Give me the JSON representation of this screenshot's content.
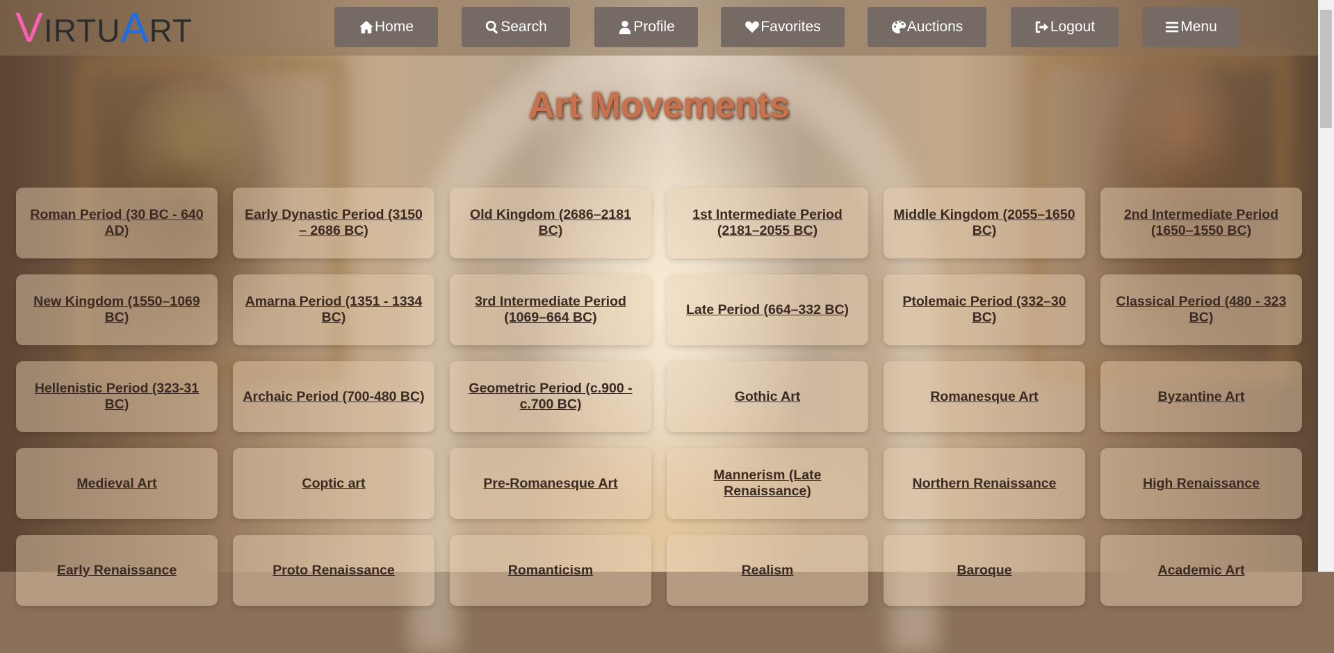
{
  "brand": {
    "v": "V",
    "irtu": "IRTU",
    "a": "A",
    "rt": "RT"
  },
  "nav": [
    {
      "label": "Home",
      "icon": "home-icon"
    },
    {
      "label": "Search",
      "icon": "search-icon"
    },
    {
      "label": "Profile",
      "icon": "user-icon"
    },
    {
      "label": "Favorites",
      "icon": "heart-icon"
    },
    {
      "label": "Auctions",
      "icon": "palette-icon"
    },
    {
      "label": "Logout",
      "icon": "sign-out-icon"
    },
    {
      "label": "Menu",
      "icon": "bars-icon"
    }
  ],
  "page_title": "Art Movements",
  "movements": [
    "Roman Period (30 BC - 640 AD)",
    "Early Dynastic Period (3150 – 2686 BC)",
    "Old Kingdom (2686–2181 BC)",
    "1st Intermediate Period (2181–2055 BC)",
    "Middle Kingdom (2055–1650 BC)",
    "2nd Intermediate Period (1650–1550 BC)",
    "New Kingdom (1550–1069 BC)",
    "Amarna Period (1351 - 1334 BC)",
    "3rd Intermediate Period (1069–664 BC)",
    "Late Period (664–332 BC)",
    "Ptolemaic Period (332–30 BC)",
    "Classical Period (480 - 323 BC)",
    "Hellenistic Period (323-31 BC)",
    "Archaic Period (700-480 BC)",
    "Geometric Period (c.900 - c.700 BC)",
    "Gothic Art",
    "Romanesque Art",
    "Byzantine Art",
    "Medieval Art",
    "Coptic art",
    "Pre-Romanesque Art",
    "Mannerism (Late Renaissance)",
    "Northern Renaissance",
    "High Renaissance",
    "Early Renaissance",
    "Proto Renaissance",
    "Romanticism",
    "Realism",
    "Baroque",
    "Academic Art"
  ],
  "colors": {
    "logo_v": "#ff5fb4",
    "logo_a": "#1e6de8",
    "nav_button": "#756b64",
    "title": "#c8724e",
    "card_text": "#3a2a22"
  }
}
